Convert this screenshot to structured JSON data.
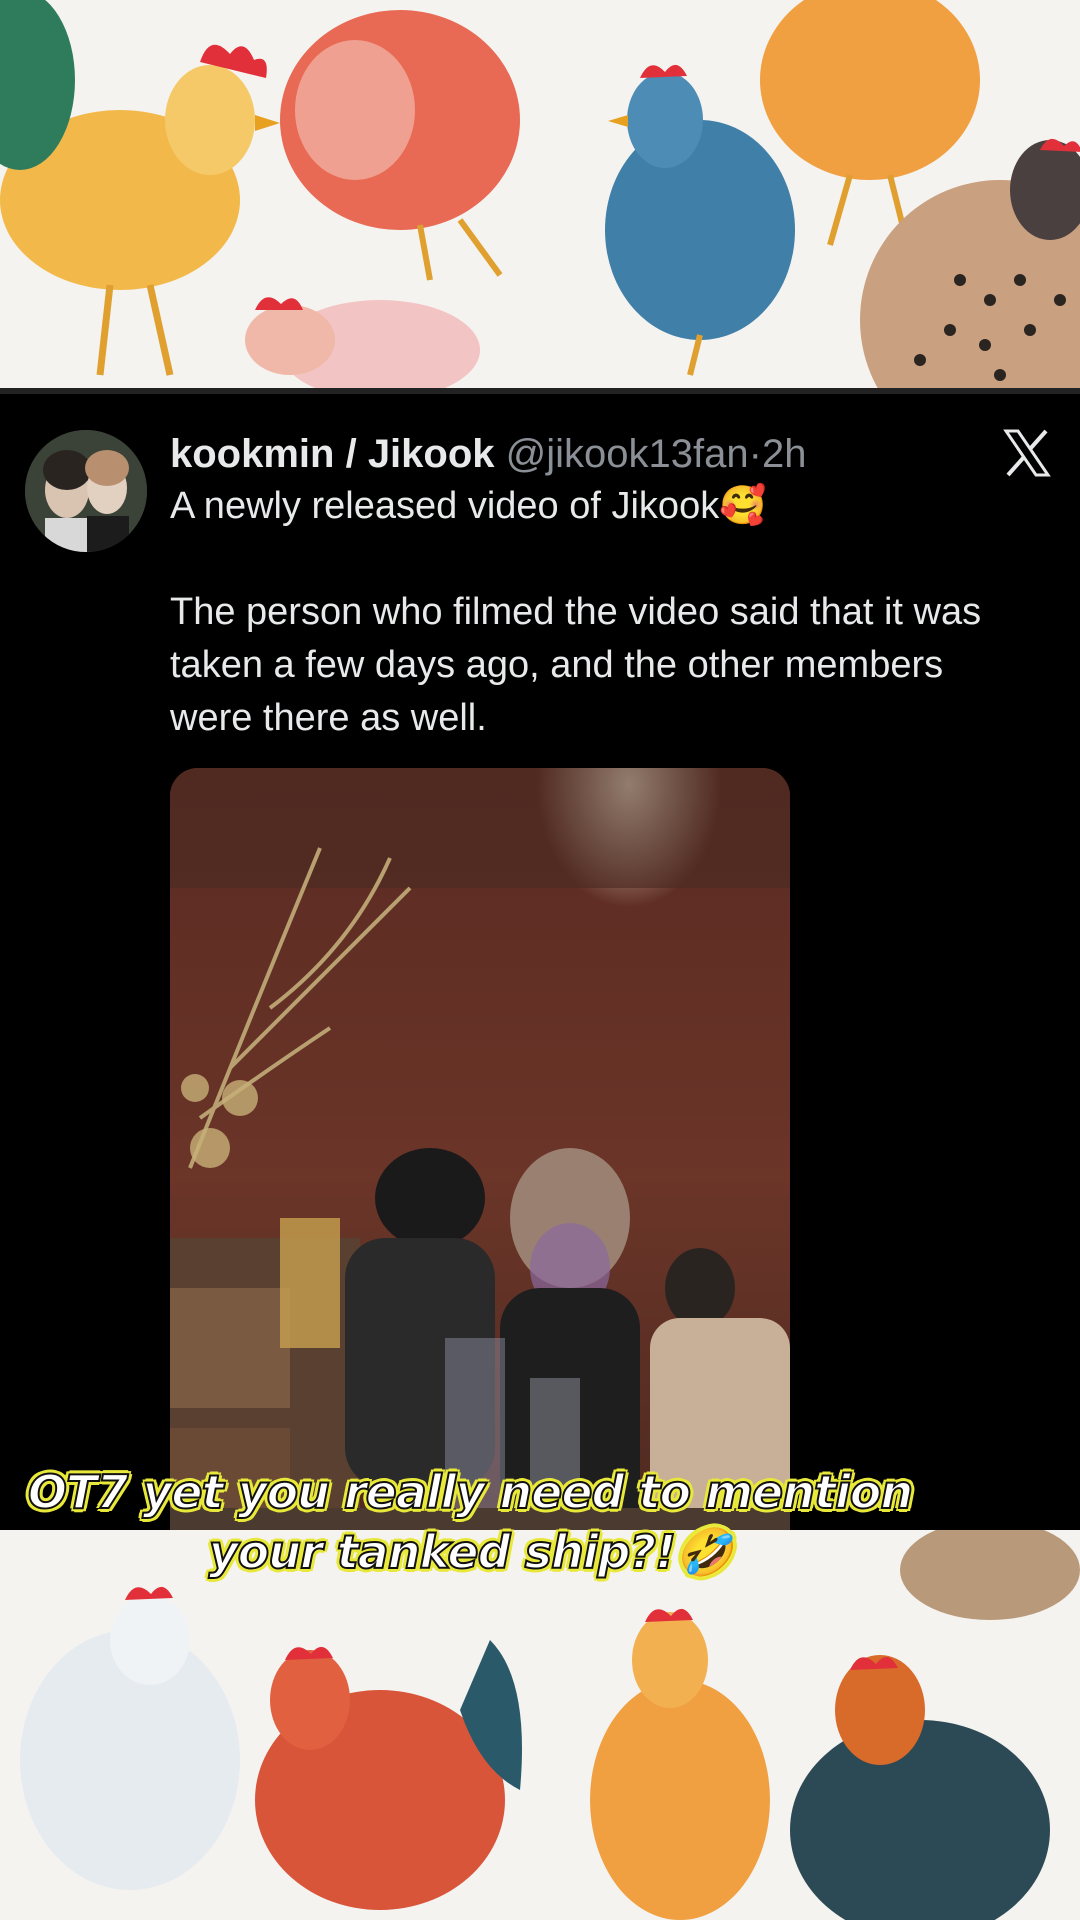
{
  "tweet": {
    "display_name": "kookmin / Jikook",
    "handle": "@jikook13fan",
    "separator": "·",
    "time": "2h",
    "line1": "A newly released video of Jikook🥰",
    "line2": "The person who filmed the video said that it was taken a few days ago, and the other members were there as well.",
    "platform_icon": "x-logo-icon"
  },
  "overlay": {
    "caption_line1": "OT7 yet you really need to mention",
    "caption_line2": "your tanked ship?!🤣"
  },
  "colors": {
    "tweet_bg": "#000000",
    "text_primary": "#e7e9ea",
    "text_secondary": "#8b9096",
    "caption_outline": "#e8e83a",
    "background": "#f5f3f0"
  }
}
